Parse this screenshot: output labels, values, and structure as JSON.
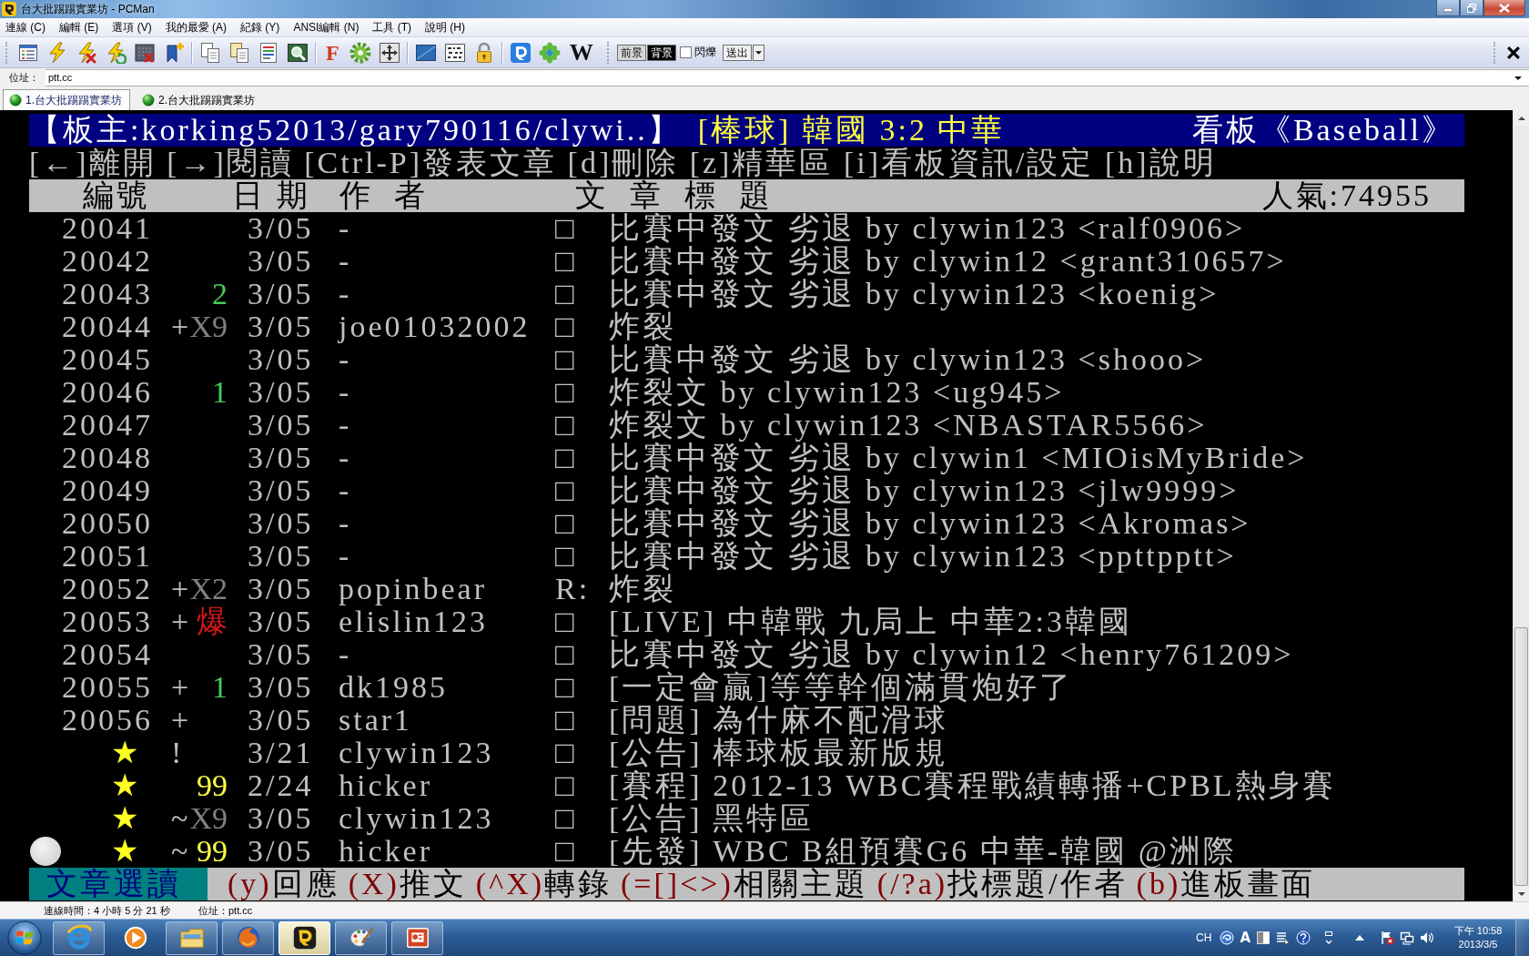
{
  "window": {
    "title": "台大批踢踢實業坊 - PCMan"
  },
  "menu": [
    "連線 (C)",
    "編輯 (E)",
    "選項 (V)",
    "我的最愛 (A)",
    "紀錄 (Y)",
    "ANSI編輯 (N)",
    "工具 (T)",
    "說明 (H)"
  ],
  "toolbar": {
    "letter_buttons": [
      "F",
      "W"
    ],
    "foreground_button": "前景",
    "background_button": "背景",
    "blink": {
      "label": "閃爍",
      "checked": false
    },
    "send_button": "送出"
  },
  "address_bar": {
    "label": "位址：",
    "value": "ptt.cc"
  },
  "tabs": [
    {
      "label": "1.台大批踢踢實業坊",
      "selected": true
    },
    {
      "label": "2.台大批踢踢實業坊",
      "selected": false
    }
  ],
  "terminal": {
    "board_header": {
      "moderators": "【板主:korking52013/gary790116/clywi..】",
      "board_title": "[棒球] 韓國 3:2 中華",
      "board_name": "看板《Baseball》"
    },
    "help_line": "[←]離開 [→]閱讀 [Ctrl-P]發表文章 [d]刪除 [z]精華區 [i]看板資訊/設定 [h]說明",
    "column_headers": [
      "編號",
      "日 期",
      "作  者",
      "文  章  標  題"
    ],
    "popularity": "人氣:74955",
    "posts": [
      {
        "kind": "normal",
        "number": "20041",
        "date": "3/05",
        "author": "-",
        "type": "□",
        "title": "比賽中發文 劣退 by clywin123 <ralf0906>"
      },
      {
        "kind": "normal",
        "number": "20042",
        "date": "3/05",
        "author": "-",
        "type": "□",
        "title": "比賽中發文 劣退 by clywin12 <grant310657>"
      },
      {
        "kind": "normal",
        "number": "20043",
        "score": "2",
        "color": "#44cc55",
        "date": "3/05",
        "author": "-",
        "type": "□",
        "title": "比賽中發文 劣退 by clywin123 <koenig>"
      },
      {
        "kind": "normal",
        "number": "20044",
        "flag": "+",
        "score": "X9",
        "color": "#808080",
        "date": "3/05",
        "author": "joe01032002",
        "type": "□",
        "title": "炸裂"
      },
      {
        "kind": "normal",
        "number": "20045",
        "date": "3/05",
        "author": "-",
        "type": "□",
        "title": "比賽中發文 劣退 by clywin123 <shooo>"
      },
      {
        "kind": "normal",
        "number": "20046",
        "score": "1",
        "color": "#44cc55",
        "date": "3/05",
        "author": "-",
        "type": "□",
        "title": "炸裂文 by clywin123 <ug945>"
      },
      {
        "kind": "normal",
        "number": "20047",
        "date": "3/05",
        "author": "-",
        "type": "□",
        "title": "炸裂文 by clywin123 <NBASTAR5566>"
      },
      {
        "kind": "normal",
        "number": "20048",
        "date": "3/05",
        "author": "-",
        "type": "□",
        "title": "比賽中發文 劣退 by clywin1 <MIOisMyBride>"
      },
      {
        "kind": "normal",
        "number": "20049",
        "date": "3/05",
        "author": "-",
        "type": "□",
        "title": "比賽中發文 劣退 by clywin123 <jlw9999>"
      },
      {
        "kind": "normal",
        "number": "20050",
        "date": "3/05",
        "author": "-",
        "type": "□",
        "title": "比賽中發文 劣退 by clywin123 <Akromas>"
      },
      {
        "kind": "normal",
        "number": "20051",
        "date": "3/05",
        "author": "-",
        "type": "□",
        "title": "比賽中發文 劣退 by clywin123 <ppttpptt>"
      },
      {
        "kind": "normal",
        "number": "20052",
        "flag": "+",
        "score": "X2",
        "color": "#808080",
        "date": "3/05",
        "author": "popinbear",
        "type": "R:",
        "title": "炸裂"
      },
      {
        "kind": "normal",
        "number": "20053",
        "flag": "+",
        "score": "爆",
        "color": "#d01818",
        "date": "3/05",
        "author": "elislin123",
        "type": "□",
        "title": "[LIVE] 中韓戰 九局上 中華2:3韓國"
      },
      {
        "kind": "normal",
        "number": "20054",
        "date": "3/05",
        "author": "-",
        "type": "□",
        "title": "比賽中發文 劣退 by clywin12 <henry761209>"
      },
      {
        "kind": "normal",
        "number": "20055",
        "flag": "+",
        "score": "1",
        "color": "#44cc55",
        "date": "3/05",
        "author": "dk1985",
        "type": "□",
        "title": "[一定會贏]等等幹個滿貫炮好了"
      },
      {
        "kind": "normal",
        "number": "20056",
        "flag": "+",
        "date": "3/05",
        "author": "star1",
        "type": "□",
        "title": "[問題] 為什麻不配滑球"
      },
      {
        "kind": "pinned",
        "number": "★",
        "flag": "!",
        "date": "3/21",
        "author": "clywin123",
        "type": "□",
        "title": "[公告] 棒球板最新版規"
      },
      {
        "kind": "pinned",
        "number": "★",
        "score": "99",
        "color": "#ffff40",
        "date": "2/24",
        "author": "hicker",
        "type": "□",
        "title": "[賽程] 2012-13 WBC賽程戰績轉播+CPBL熱身賽"
      },
      {
        "kind": "pinned",
        "number": "★",
        "flag": "~",
        "score": "X9",
        "color": "#808080",
        "date": "3/05",
        "author": "clywin123",
        "type": "□",
        "title": "[公告] 黑特區"
      },
      {
        "kind": "pinned",
        "number": "★",
        "flag": "~",
        "score": "99",
        "color": "#ffff40",
        "date": "3/05",
        "author": "hicker",
        "type": "□",
        "title": "[先發] WBC B組預賽G6 中華-韓國 @洲際"
      }
    ],
    "footer": {
      "mode": "文章選讀",
      "commands": [
        {
          "key": "(y)",
          "label": "回應"
        },
        {
          "key": "(X)",
          "label": "推文"
        },
        {
          "key": "(^X)",
          "label": "轉錄"
        },
        {
          "key": "(=[]<>)",
          "label": "相關主題"
        },
        {
          "key": "(/?a)",
          "label": "找標題/作者"
        },
        {
          "key": "(b)",
          "label": "進板畫面"
        }
      ]
    }
  },
  "status_bar": {
    "connection_time": "連線時間：4 小時 5 分 21 秒",
    "address": "位址：ptt.cc"
  },
  "taskbar": {
    "apps": [
      {
        "running": true,
        "selected": false
      },
      {
        "running": false,
        "selected": false
      },
      {
        "running": true,
        "selected": false
      },
      {
        "running": true,
        "selected": false
      },
      {
        "running": true,
        "selected": true
      },
      {
        "running": true,
        "selected": false
      },
      {
        "running": true,
        "selected": false
      }
    ],
    "language": "CH",
    "input_mode": "A",
    "time": "下午 10:58",
    "date": "2013/3/5"
  }
}
